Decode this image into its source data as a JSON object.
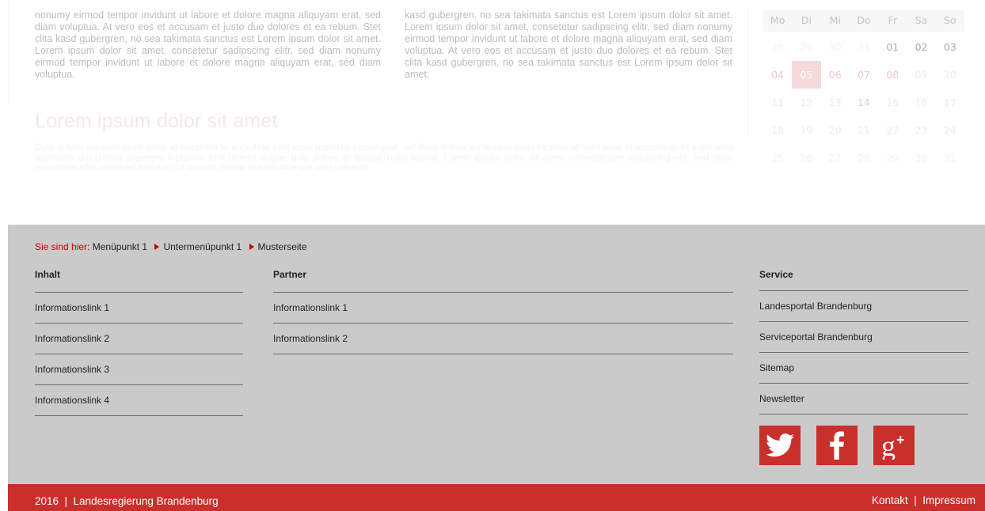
{
  "content": {
    "col_left": "nonumy eirmod tempor invidunt ut labore et dolore magna aliquyam erat, sed diam voluptua. At vero eos et accusam et justo duo dolores et ea rebum. Stet clita kasd gubergren, no sea takimata sanctus est Lorem ipsum dolor sit amet. Lorem ipsum dolor sit amet, consetetur sadipscing elitr, sed diam nonumy eirmod tempor invidunt ut labore et dolore magna aliquyam erat, sed diam voluptua.",
    "col_mid": "kasd gubergren, no sea takimata sanctus est Lorem ipsum dolor sit amet. Lorem ipsum dolor sit amet, consetetur sadipscing elitr, sed diam nonumy eirmod tempor invidunt ut labore et dolore magna aliquyam erat, sed diam voluptua. At vero eos et accusam et justo duo dolores et ea rebum. Stet clita kasd gubergren, no sea takimata sanctus est Lorem ipsum dolor sit amet.",
    "heading": "Lorem ipsum dolor sit amet",
    "body": "Duis autem vel eum iriure dolor in hendrerit in vulputate velit esse molestie consequat, vel illum dolore eu feugiat nulla facilisis at vero eros et accumsan et iusto odio dignissim qui blandit praesent luptatum zzril delenit augue duis dolore te feugait nulla facilisi. Lorem ipsum dolor sit amet, consectetuer adipiscing elit, sed diam nonummy nibh euismod tincidunt ut laoreet dolore magna aliquam erat volutpat."
  },
  "calendar": {
    "weekdays": [
      "Mo",
      "Di",
      "Mi",
      "Do",
      "Fr",
      "Sa",
      "So"
    ],
    "weeks": [
      [
        "28",
        "29",
        "30",
        "31",
        "01",
        "02",
        "03"
      ],
      [
        "04",
        "05",
        "06",
        "07",
        "08",
        "09",
        "10"
      ],
      [
        "11",
        "12",
        "13",
        "14",
        "15",
        "16",
        "17"
      ],
      [
        "18",
        "19",
        "20",
        "21",
        "22",
        "23",
        "24"
      ],
      [
        "25",
        "26",
        "27",
        "28",
        "29",
        "30",
        "31"
      ]
    ]
  },
  "breadcrumb": {
    "label": "Sie sind hier:",
    "items": [
      "Menüpunkt 1",
      "Untermenüpunkt 1",
      "Musterseite"
    ]
  },
  "footer": {
    "columns": [
      {
        "title": "Inhalt",
        "links": [
          "Informationslink 1",
          "Informationslink 2",
          "Informationslink 3",
          "Informationslink 4"
        ]
      },
      {
        "title": "Partner",
        "links": [
          "Informationslink 1",
          "Informationslink 2"
        ]
      },
      {
        "title": "Service",
        "links": [
          "Landesportal Brandenburg",
          "Serviceportal Brandenburg",
          "Sitemap",
          "Newsletter"
        ]
      }
    ],
    "social": [
      "twitter-icon",
      "facebook-icon",
      "google-plus-icon"
    ]
  },
  "bottom": {
    "left": "2016  |  Landesregierung Brandenburg",
    "right": "Kontakt  |  Impressum"
  },
  "colors": {
    "accent": "#c9302c",
    "footer_bg": "#cacaca",
    "breadcrumb_label": "#c10000"
  }
}
